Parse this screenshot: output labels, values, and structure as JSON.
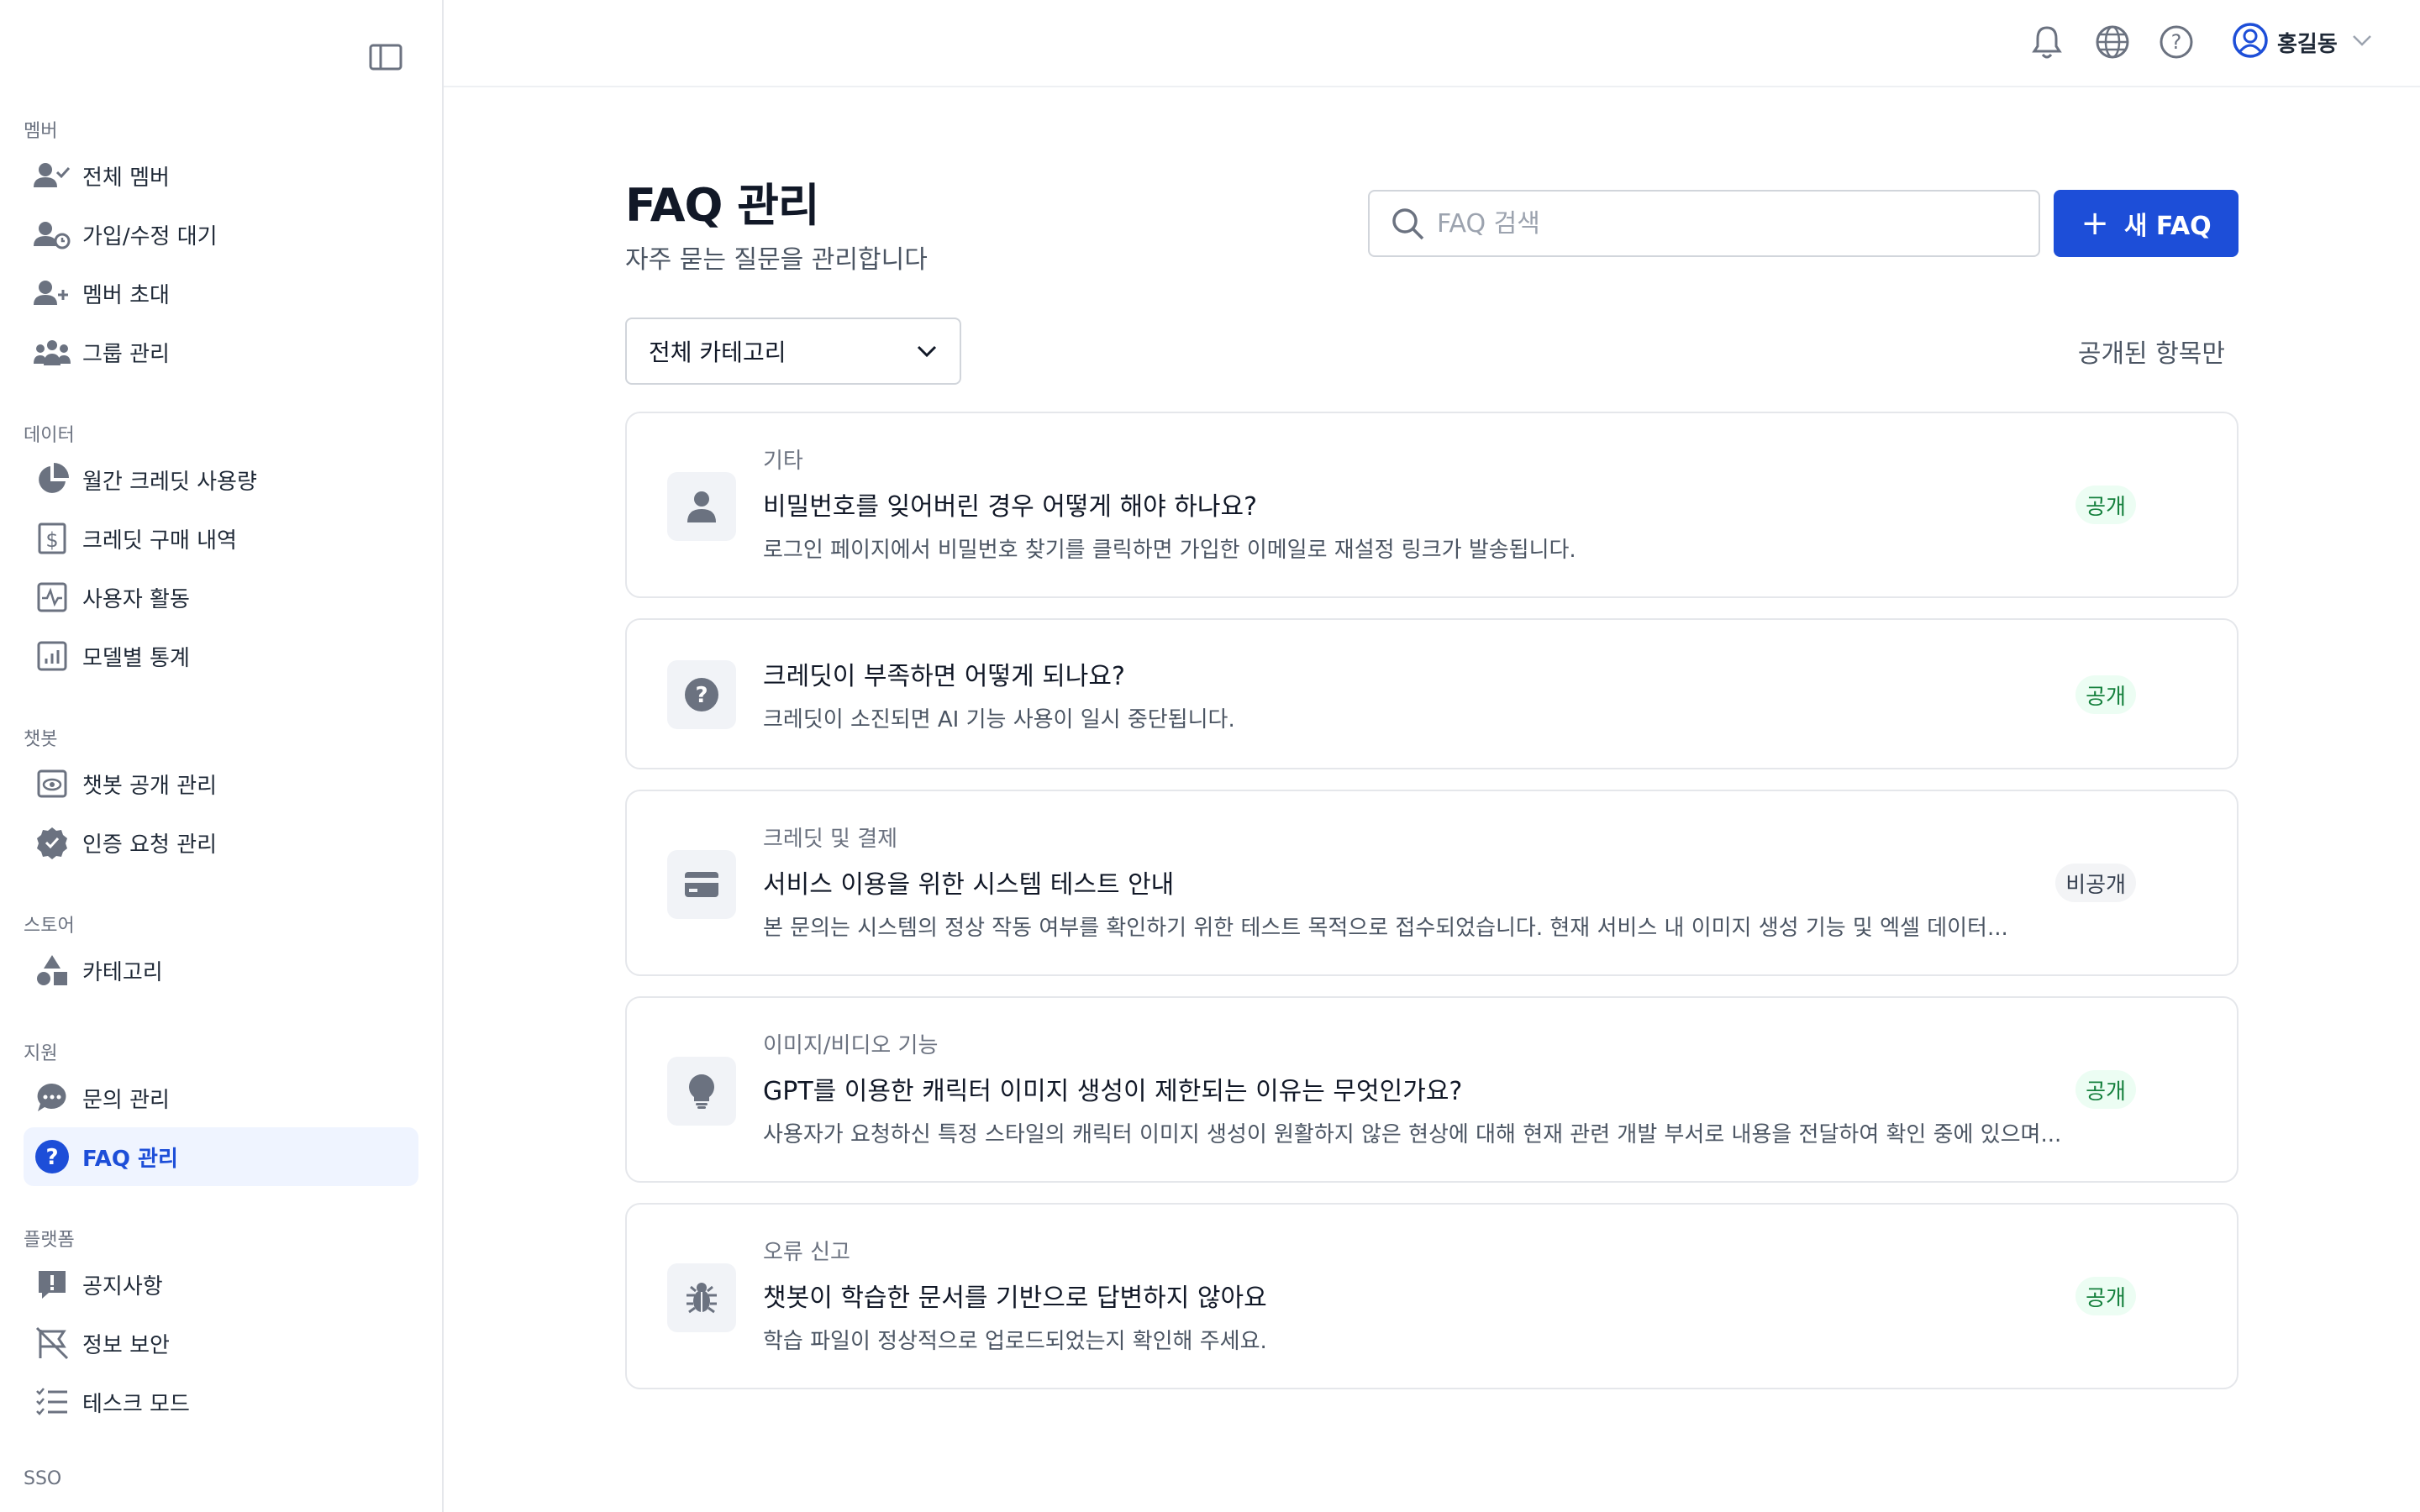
{
  "sidebar": {
    "sections": [
      {
        "title": "멤버",
        "items": [
          {
            "label": "전체 멤버",
            "icon": "user-check-icon"
          },
          {
            "label": "가입/수정 대기",
            "icon": "user-clock-icon"
          },
          {
            "label": "멤버 초대",
            "icon": "user-plus-icon"
          },
          {
            "label": "그룹 관리",
            "icon": "users-group-icon"
          }
        ]
      },
      {
        "title": "데이터",
        "items": [
          {
            "label": "월간 크레딧 사용량",
            "icon": "pie-chart-icon"
          },
          {
            "label": "크레딧 구매 내역",
            "icon": "dollar-receipt-icon"
          },
          {
            "label": "사용자 활동",
            "icon": "activity-icon"
          },
          {
            "label": "모델별 통계",
            "icon": "bar-chart-icon"
          }
        ]
      },
      {
        "title": "챗봇",
        "items": [
          {
            "label": "챗봇 공개 관리",
            "icon": "eye-icon"
          },
          {
            "label": "인증 요청 관리",
            "icon": "verified-badge-icon"
          }
        ]
      },
      {
        "title": "스토어",
        "items": [
          {
            "label": "카테고리",
            "icon": "shapes-icon"
          }
        ]
      },
      {
        "title": "지원",
        "items": [
          {
            "label": "문의 관리",
            "icon": "chat-bubble-icon"
          },
          {
            "label": "FAQ 관리",
            "icon": "question-circle-icon"
          }
        ]
      },
      {
        "title": "플랫폼",
        "items": [
          {
            "label": "공지사항",
            "icon": "announcement-icon"
          },
          {
            "label": "정보 보안",
            "icon": "flag-off-icon"
          },
          {
            "label": "테스크 모드",
            "icon": "checklist-icon"
          }
        ]
      },
      {
        "title": "SSO",
        "items": []
      }
    ]
  },
  "header": {
    "user_name": "홍길동"
  },
  "main": {
    "title": "FAQ 관리",
    "subtitle": "자주 묻는 질문을 관리합니다",
    "search_placeholder": "FAQ 검색",
    "new_button_label": "새 FAQ",
    "category_filter": "전체 카테고리",
    "public_only_label": "공개된 항목만",
    "faqs": [
      {
        "category": "기타",
        "question": "비밀번호를 잊어버린 경우 어떻게 해야 하나요?",
        "answer": "로그인 페이지에서 비밀번호 찾기를 클릭하면 가입한 이메일로 재설정 링크가 발송됩니다.",
        "status": "공개",
        "icon": "user-icon"
      },
      {
        "category": "",
        "question": "크레딧이 부족하면 어떻게 되나요?",
        "answer": "크레딧이 소진되면 AI 기능 사용이 일시 중단됩니다.",
        "status": "공개",
        "icon": "question-circle-icon"
      },
      {
        "category": "크레딧 및 결제",
        "question": "서비스 이용을 위한 시스템 테스트 안내",
        "answer": "본 문의는 시스템의 정상 작동 여부를 확인하기 위한 테스트 목적으로 접수되었습니다. 현재 서비스 내 이미지 생성 기능 및 엑셀 데이터...",
        "status": "비공개",
        "icon": "credit-card-icon"
      },
      {
        "category": "이미지/비디오 기능",
        "question": "GPT를 이용한 캐릭터 이미지 생성이 제한되는 이유는 무엇인가요?",
        "answer": "사용자가 요청하신 특정 스타일의 캐릭터 이미지 생성이 원활하지 않은 현상에 대해 현재 관련 개발 부서로 내용을 전달하여 확인 중에 있으며...",
        "status": "공개",
        "icon": "lightbulb-icon"
      },
      {
        "category": "오류 신고",
        "question": "챗봇이 학습한 문서를 기반으로 답변하지 않아요",
        "answer": "학습 파일이 정상적으로 업로드되었는지 확인해 주세요.",
        "status": "공개",
        "icon": "bug-icon"
      }
    ]
  },
  "colors": {
    "accent": "#1d4ed8",
    "public_badge_bg": "#ecfdf3",
    "public_badge_text": "#15803d",
    "private_badge_bg": "#f3f4f6"
  }
}
